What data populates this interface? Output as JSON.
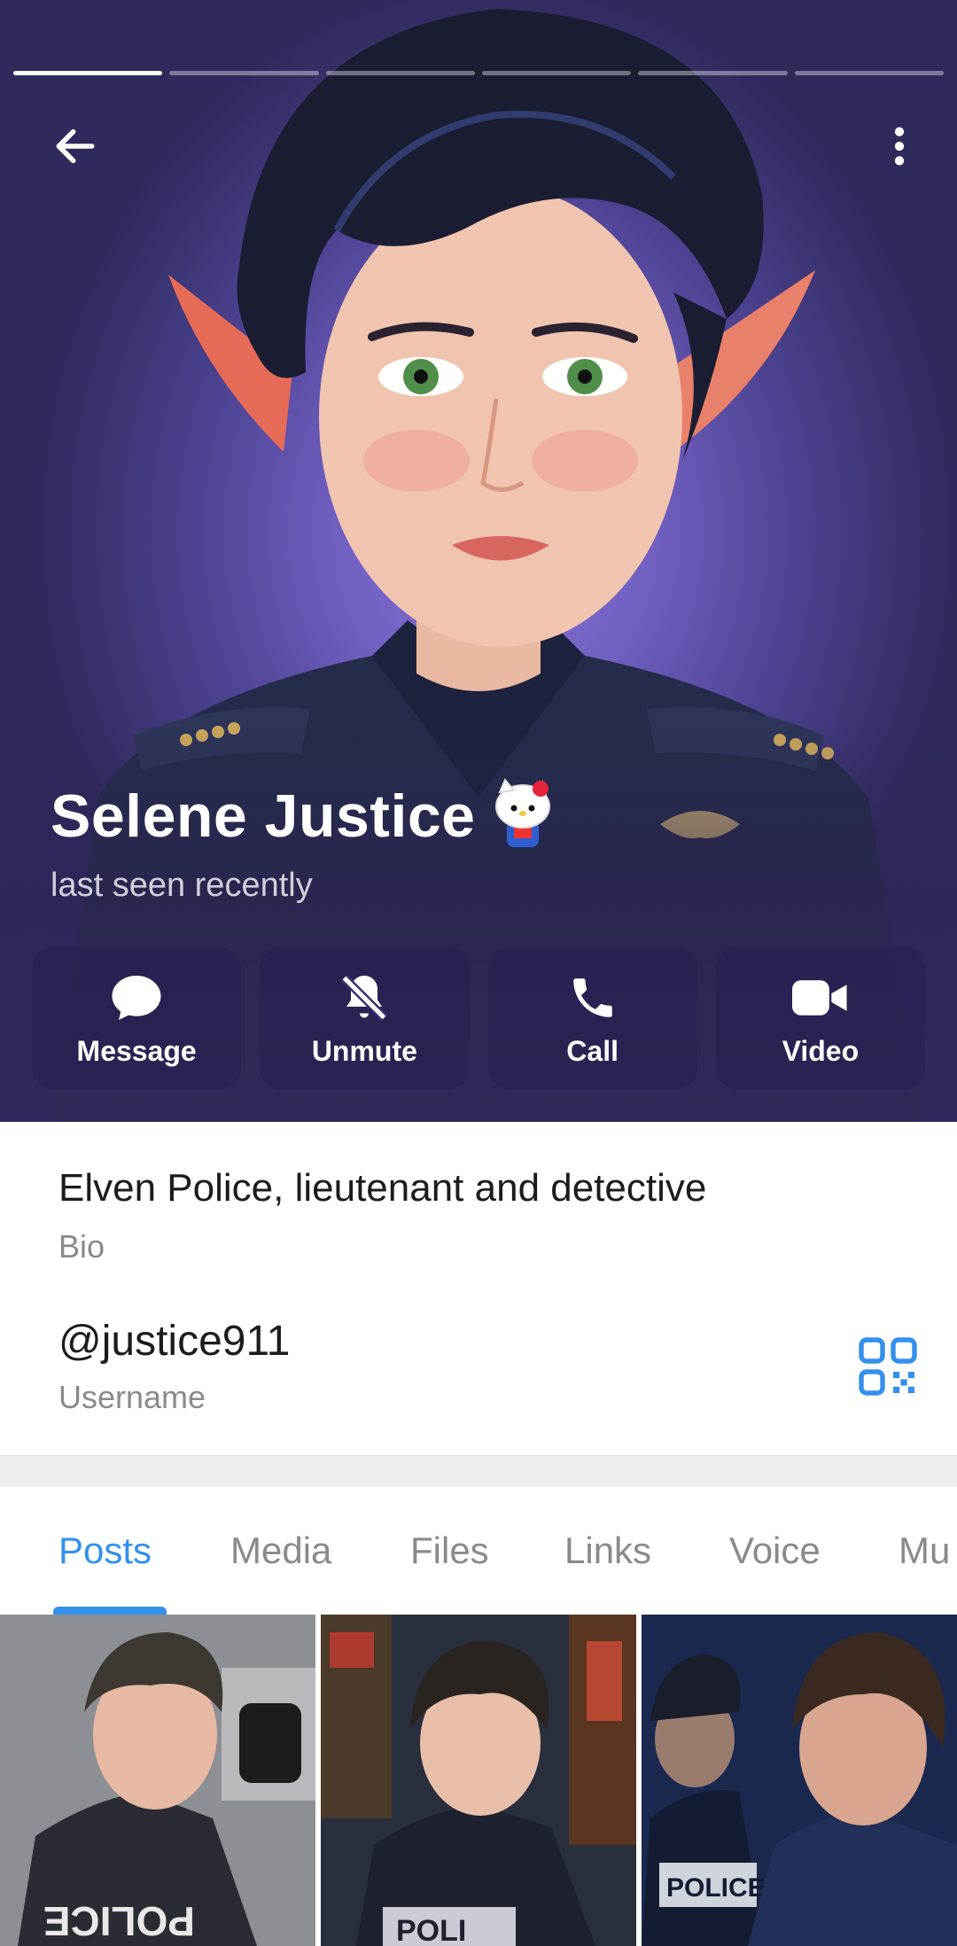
{
  "profile": {
    "name": "Selene Justice",
    "status": "last seen recently",
    "bio": "Elven Police, lieutenant and detective",
    "bio_caption": "Bio",
    "username": "@justice911",
    "username_caption": "Username"
  },
  "story_bars": {
    "count": 6,
    "active_index": 0
  },
  "actions": [
    {
      "label": "Message",
      "icon": "chat-bubble-icon"
    },
    {
      "label": "Unmute",
      "icon": "bell-off-icon"
    },
    {
      "label": "Call",
      "icon": "phone-icon"
    },
    {
      "label": "Video",
      "icon": "video-camera-icon"
    }
  ],
  "tabs": [
    "Posts",
    "Media",
    "Files",
    "Links",
    "Voice",
    "Mu"
  ],
  "active_tab": "Posts",
  "colors": {
    "accent": "#3390ec",
    "hero_purple": "#6f5fc0"
  }
}
